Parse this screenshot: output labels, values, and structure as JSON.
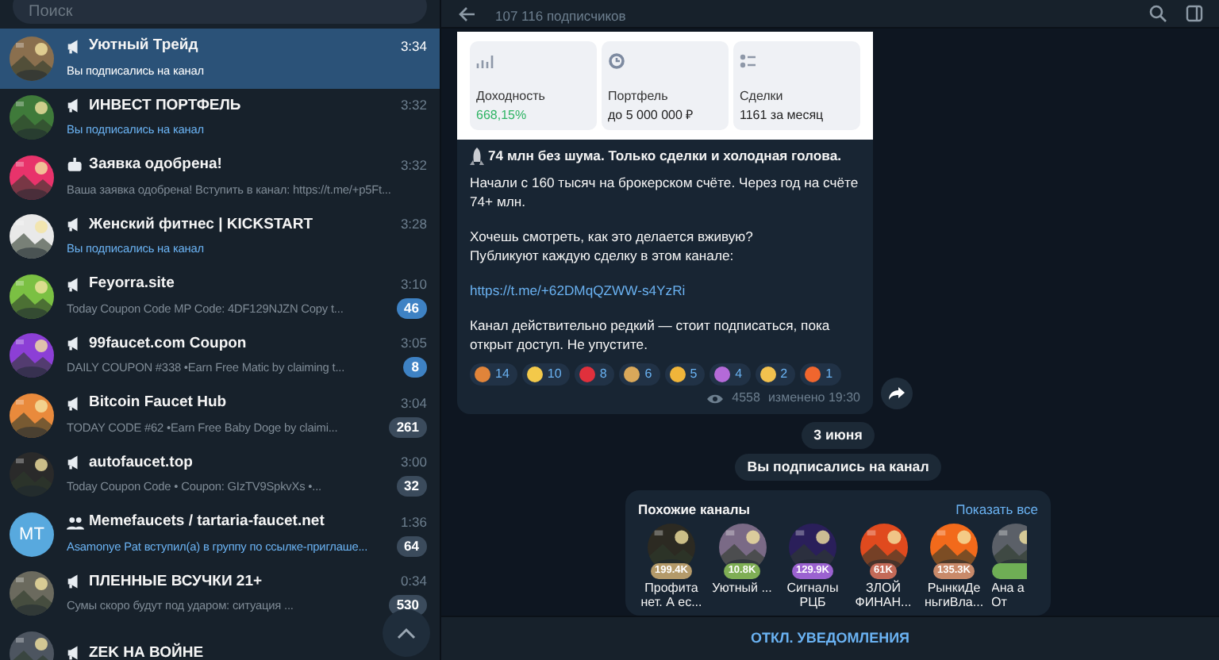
{
  "search": {
    "placeholder": "Поиск"
  },
  "chats": [
    {
      "kind": "channel",
      "title": "Уютный Трейд",
      "time": "3:34",
      "preview": "Вы подписались на канал",
      "service": true,
      "selected": true
    },
    {
      "kind": "channel",
      "title": "ИНВЕСТ ПОРТФЕЛЬ",
      "time": "3:32",
      "preview": "Вы подписались на канал",
      "service": true,
      "selected": false
    },
    {
      "kind": "bot",
      "title": "Заявка одобрена!",
      "time": "3:32",
      "preview": "Ваша заявка одобрена!  Вступить в канал: https://t.me/+p5Ft...",
      "service": false,
      "selected": false
    },
    {
      "kind": "channel",
      "title": "Женский фитнес | KICKSTART",
      "time": "3:28",
      "preview": "Вы подписались на канал",
      "service": true,
      "selected": false
    },
    {
      "kind": "channel",
      "title": "Feyorra.site",
      "time": "3:10",
      "preview": "Today Coupon Code  MP Code: 4DF129NJZN  Copy t...",
      "service": false,
      "selected": false,
      "badge": {
        "count": "46",
        "muted": false
      }
    },
    {
      "kind": "channel",
      "title": "99faucet.com Coupon",
      "time": "3:05",
      "preview": "DAILY COUPON #338  •Earn Free Matic by claiming t...",
      "service": false,
      "selected": false,
      "badge": {
        "count": "8",
        "muted": false
      }
    },
    {
      "kind": "channel",
      "title": "Bitcoin Faucet Hub",
      "time": "3:04",
      "preview": "TODAY CODE #62  •Earn Free Baby Doge by claimi...",
      "service": false,
      "selected": false,
      "badge": {
        "count": "261",
        "muted": true
      }
    },
    {
      "kind": "channel",
      "title": "autofaucet.top",
      "time": "3:00",
      "preview": "Today Coupon Code   • Coupon: GIzTV9SpkvXs  •...",
      "service": false,
      "selected": false,
      "badge": {
        "count": "32",
        "muted": true
      }
    },
    {
      "kind": "group",
      "title": "Memefaucets / tartaria-faucet.net",
      "time": "1:36",
      "preview": "Asamonye Pat вступил(а) в группу по ссылке-приглаше...",
      "service": true,
      "selected": false,
      "avatar": {
        "kind": "initials",
        "text": "MT"
      },
      "badge": {
        "count": "64",
        "muted": true
      }
    },
    {
      "kind": "channel",
      "title": "ПЛЕННЫЕ ВСУЧКИ 21+",
      "time": "0:34",
      "preview": "Сумы скоро будут под ударом: ситуация ...",
      "service": false,
      "selected": false,
      "badge": {
        "count": "530",
        "muted": true
      }
    },
    {
      "kind": "channel",
      "title": "ZEK НА ВОЙНЕ",
      "selected": false
    }
  ],
  "header": {
    "subtitle": "107 116 подписчиков"
  },
  "post": {
    "stats": [
      {
        "label": "Доходность",
        "value": "668,15%",
        "color": "#2fb464"
      },
      {
        "label": "Портфель",
        "value": "до 5 000 000 ₽",
        "color": "#222222"
      },
      {
        "label": "Сделки",
        "value": "1161 за месяц",
        "color": "#222222"
      }
    ],
    "headline": "74 млн без шума. Только сделки и холодная голова.",
    "paragraphs": [
      {
        "kind": "text",
        "lines": [
          "Начали с 160 тысяч на брокерском счёте. Через год на счёте 74+ млн."
        ]
      },
      {
        "kind": "text",
        "lines": [
          "Хочешь смотреть, как это делается вживую?",
          "Публикуют каждую сделку в этом канале:"
        ]
      },
      {
        "kind": "link",
        "lines": [
          "https://t.me/+62DMqQZWW-s4YzRi"
        ]
      },
      {
        "kind": "text",
        "lines": [
          "Канал действительно редкий — стоит подписаться, пока открыт доступ. Не упустите."
        ]
      }
    ],
    "reactions": [
      {
        "color": "#e0843a",
        "count": "14"
      },
      {
        "color": "#f3c94a",
        "count": "10"
      },
      {
        "color": "#e0303c",
        "count": "8"
      },
      {
        "color": "#d9a85a",
        "count": "6"
      },
      {
        "color": "#f0b53a",
        "count": "5"
      },
      {
        "color": "#b46ad8",
        "count": "4"
      },
      {
        "color": "#f2c14e",
        "count": "2"
      },
      {
        "color": "#f0662e",
        "count": "1"
      }
    ],
    "views": "4558",
    "edited": "изменено 19:30"
  },
  "date_pill": "3 июня",
  "service": "Вы подписались на канал",
  "similar": {
    "title": "Похожие каналы",
    "show_all": "Показать все",
    "channels": [
      {
        "name": "Профита нет. А ес...",
        "count": "199.4K",
        "color": "#b49a6a"
      },
      {
        "name": "Уютный ...",
        "count": "10.8K",
        "color": "#7fae55"
      },
      {
        "name": "Сигналы РЦБ",
        "count": "129.9K",
        "color": "#9b62d0"
      },
      {
        "name": "ЗЛОЙ ФИНАН...",
        "count": "61K",
        "color": "#c46a58"
      },
      {
        "name": "РынкиДе ньгиВла...",
        "count": "135.3K",
        "color": "#c98a6a"
      },
      {
        "name": "Ана а От",
        "color": "#6fae55"
      }
    ]
  },
  "bottom": {
    "button": "ОТКЛ. УВЕДОМЛЕНИЯ"
  }
}
